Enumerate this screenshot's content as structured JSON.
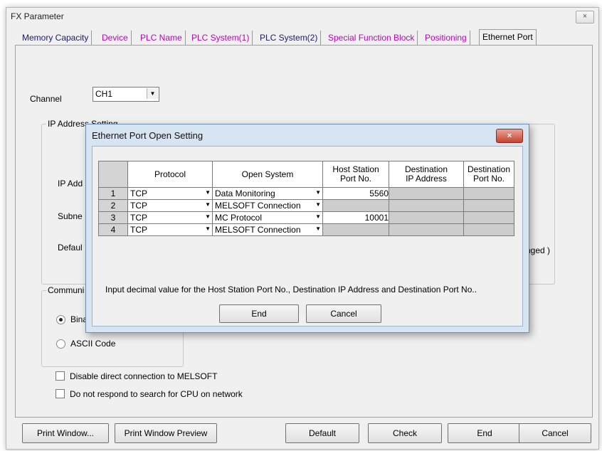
{
  "window": {
    "title": "FX Parameter",
    "close_glyph": "×"
  },
  "tabs": [
    {
      "label": "Memory Capacity",
      "state": "dark"
    },
    {
      "label": "Device",
      "state": "pink"
    },
    {
      "label": "PLC Name",
      "state": "pink"
    },
    {
      "label": "PLC System(1)",
      "state": "pink"
    },
    {
      "label": "PLC System(2)",
      "state": "dark"
    },
    {
      "label": "Special Function Block",
      "state": "pink"
    },
    {
      "label": "Positioning",
      "state": "pink"
    },
    {
      "label": "Ethernet Port",
      "state": "active"
    }
  ],
  "channel": {
    "label": "Channel",
    "value": "CH1"
  },
  "ip_group": {
    "title_visible": "IP Address Setting",
    "ip_label_partial": "IP Add",
    "subnet_label_partial": "Subne",
    "default_label_partial": "Defaul",
    "changed_text": "nged  )"
  },
  "comm_group": {
    "title_partial": "Communi",
    "option_binary_partial": "Bina",
    "option_ascii": "ASCII Code"
  },
  "checkboxes": [
    {
      "label": "Disable direct connection to MELSOFT",
      "checked": false
    },
    {
      "label": "Do not respond to search for CPU on network",
      "checked": false
    }
  ],
  "bottom_buttons": {
    "print_window": "Print Window...",
    "print_preview": "Print Window Preview",
    "default": "Default",
    "check": "Check",
    "end": "End",
    "cancel": "Cancel"
  },
  "dialog": {
    "title": "Ethernet Port Open Setting",
    "close_glyph": "×",
    "columns": {
      "protocol": "Protocol",
      "open_system": "Open System",
      "host_port_line1": "Host Station",
      "host_port_line2": "Port No.",
      "dest_ip_line1": "Destination",
      "dest_ip_line2": "IP Address",
      "dest_port_line1": "Destination",
      "dest_port_line2": "Port No."
    },
    "rows": [
      {
        "no": "1",
        "protocol": "TCP",
        "open_system": "Data Monitoring",
        "host_port": "5560"
      },
      {
        "no": "2",
        "protocol": "TCP",
        "open_system": "MELSOFT Connection",
        "host_port": ""
      },
      {
        "no": "3",
        "protocol": "TCP",
        "open_system": "MC Protocol",
        "host_port": "10001"
      },
      {
        "no": "4",
        "protocol": "TCP",
        "open_system": "MELSOFT Connection",
        "host_port": ""
      }
    ],
    "note": "Input decimal value for the Host Station Port No., Destination IP Address and Destination Port No..",
    "end_button": "End",
    "cancel_button": "Cancel"
  }
}
